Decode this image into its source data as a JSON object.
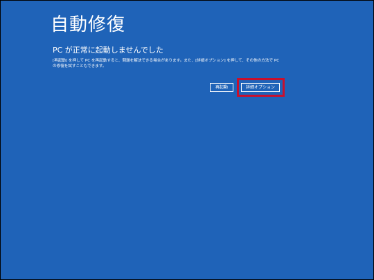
{
  "page": {
    "title": "自動修復",
    "heading": "PC が正常に起動しませんでした",
    "message": "[再起動] を押して PC を再起動すると、問題を解決できる場合があります。また、[詳細オプション] を押して、その他の方法で PC の修復を試すこともできます。"
  },
  "buttons": {
    "restart_label": "再起動",
    "advanced_label": "詳細オプション"
  },
  "colors": {
    "background": "#1f63b8",
    "text": "#ffffff",
    "highlight_border": "#c8102e"
  }
}
